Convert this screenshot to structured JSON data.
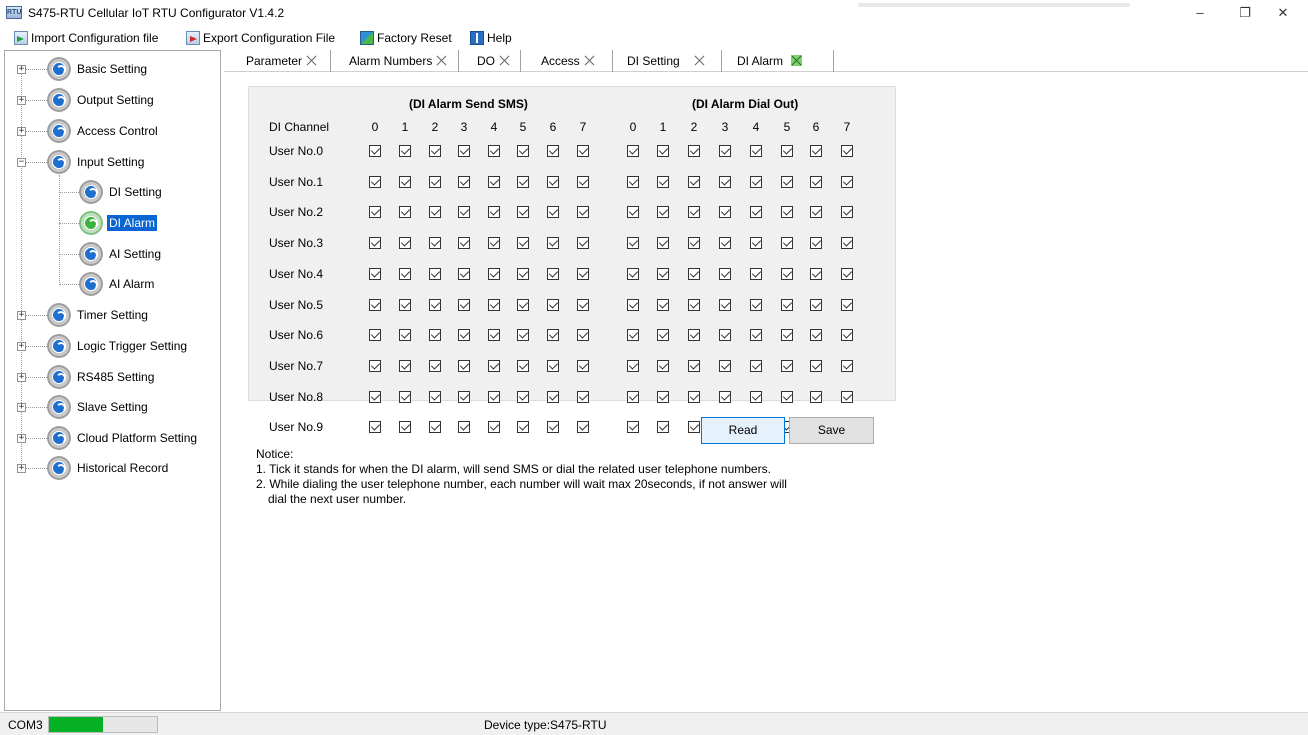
{
  "window": {
    "title": "S475-RTU Cellular IoT RTU Configurator V1.4.2",
    "minimize": "–",
    "restore": "❐",
    "close": "✕"
  },
  "toolbar": {
    "import_label": "Import Configuration file",
    "export_label": "Export Configuration File",
    "reset_label": "Factory Reset",
    "help_label": "Help"
  },
  "tree": {
    "items": [
      {
        "label": "Basic Setting",
        "expander": "+"
      },
      {
        "label": "Output Setting",
        "expander": "+"
      },
      {
        "label": "Access Control",
        "expander": "+"
      },
      {
        "label": "Input Setting",
        "expander": "−"
      },
      {
        "label": "DI Setting"
      },
      {
        "label": "DI Alarm"
      },
      {
        "label": "AI Setting"
      },
      {
        "label": "AI Alarm"
      },
      {
        "label": "Timer Setting",
        "expander": "+"
      },
      {
        "label": "Logic Trigger Setting",
        "expander": "+"
      },
      {
        "label": "RS485 Setting",
        "expander": "+"
      },
      {
        "label": "Slave Setting",
        "expander": "+"
      },
      {
        "label": "Cloud Platform Setting",
        "expander": "+"
      },
      {
        "label": "Historical Record",
        "expander": "+"
      }
    ],
    "selected": "DI Alarm"
  },
  "tabs": [
    {
      "label": "Parameter"
    },
    {
      "label": "Alarm Numbers"
    },
    {
      "label": "DO"
    },
    {
      "label": "Access"
    },
    {
      "label": "DI Setting"
    },
    {
      "label": "DI Alarm",
      "active": true
    }
  ],
  "alarm": {
    "sms_title": "(DI Alarm Send SMS)",
    "dial_title": "(DI Alarm Dial Out)",
    "channel_header": "DI Channel",
    "channels": [
      "0",
      "1",
      "2",
      "3",
      "4",
      "5",
      "6",
      "7"
    ],
    "users": [
      "User No.0",
      "User No.1",
      "User No.2",
      "User No.3",
      "User No.4",
      "User No.5",
      "User No.6",
      "User No.7",
      "User No.8",
      "User No.9"
    ],
    "all_checked": true
  },
  "buttons": {
    "read": "Read",
    "save": "Save"
  },
  "notice": {
    "title": "Notice:",
    "line1": "1. Tick it stands for when the DI alarm, will send SMS or dial the related user telephone numbers.",
    "line2": "2. While dialing the user telephone number, each number will wait max 20seconds, if not answer will",
    "line3": "dial the next user number."
  },
  "status": {
    "port": "COM3",
    "progress_percent": 50,
    "device": "Device type:S475-RTU"
  },
  "colors": {
    "selection": "#0a64d2",
    "progress": "#06b025",
    "active_tab_close": "#7cd36e"
  }
}
